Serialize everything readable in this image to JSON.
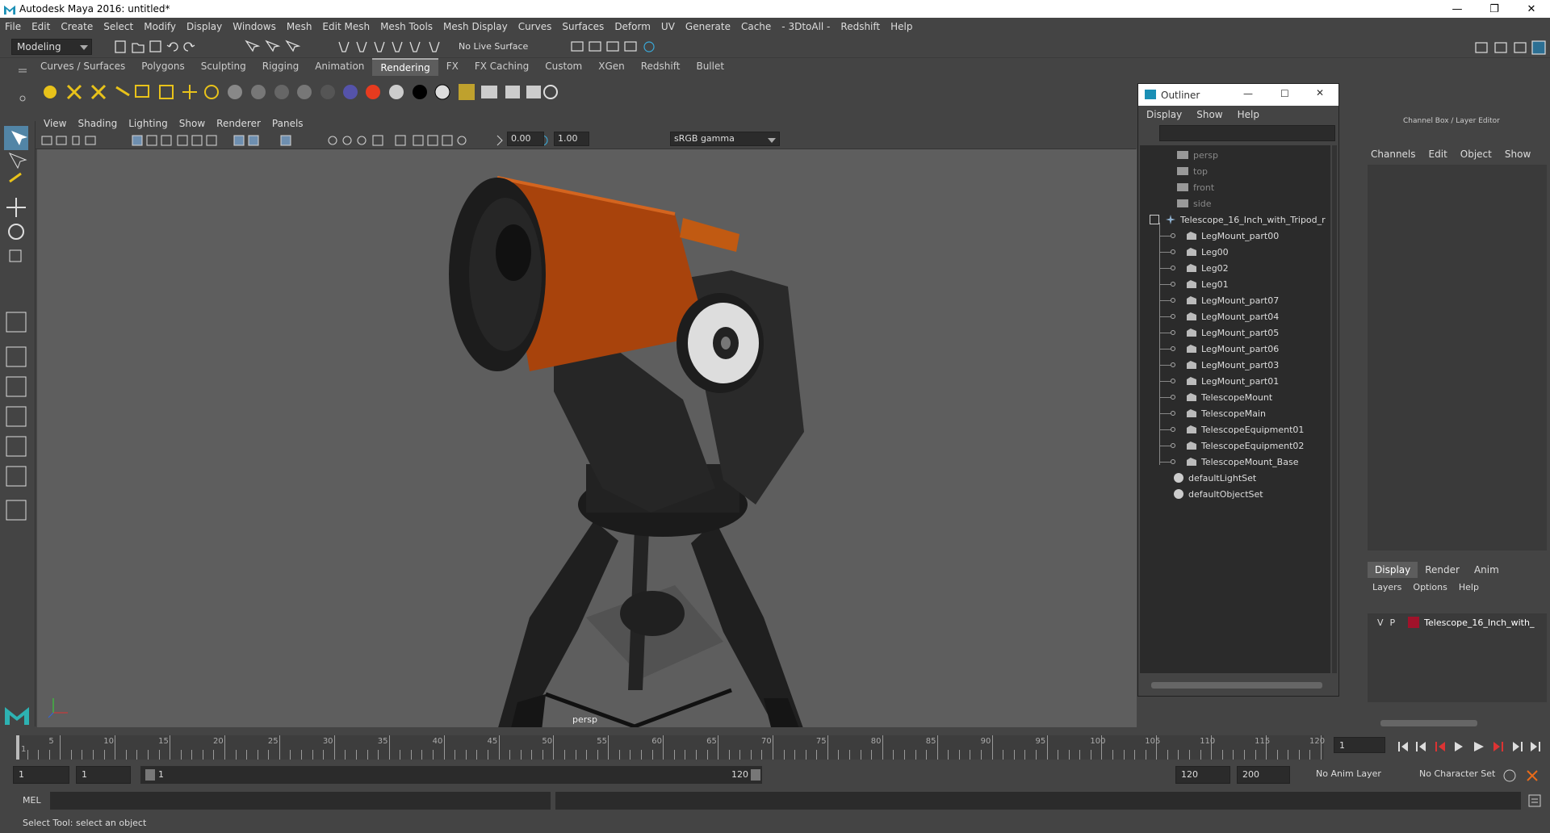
{
  "window": {
    "title": "Autodesk Maya 2016: untitled*",
    "minimize": "—",
    "restore": "❐",
    "close": "✕"
  },
  "menubar": [
    "File",
    "Edit",
    "Create",
    "Select",
    "Modify",
    "Display",
    "Windows",
    "Mesh",
    "Edit Mesh",
    "Mesh Tools",
    "Mesh Display",
    "Curves",
    "Surfaces",
    "Deform",
    "UV",
    "Generate",
    "Cache",
    "- 3DtoAll -",
    "Redshift",
    "Help"
  ],
  "status": {
    "mode": "Modeling",
    "live_surface": "No Live Surface"
  },
  "shelf_tabs": [
    "Curves / Surfaces",
    "Polygons",
    "Sculpting",
    "Rigging",
    "Animation",
    "Rendering",
    "FX",
    "FX Caching",
    "Custom",
    "XGen",
    "Redshift",
    "Bullet"
  ],
  "active_shelf_tab": "Rendering",
  "panel_menu": [
    "View",
    "Shading",
    "Lighting",
    "Show",
    "Renderer",
    "Panels"
  ],
  "panel_toolbar": {
    "exposure": "0.00",
    "gamma": "1.00",
    "color_space": "sRGB gamma"
  },
  "viewport": {
    "camera_label": "persp"
  },
  "outliner": {
    "title": "Outliner",
    "menu": [
      "Display",
      "Show",
      "Help"
    ],
    "cameras": [
      "persp",
      "top",
      "front",
      "side"
    ],
    "root": "Telescope_16_Inch_with_Tripod_r",
    "children": [
      "LegMount_part00",
      "Leg00",
      "Leg02",
      "Leg01",
      "LegMount_part07",
      "LegMount_part04",
      "LegMount_part05",
      "LegMount_part06",
      "LegMount_part03",
      "LegMount_part01",
      "TelescopeMount",
      "TelescopeMain",
      "TelescopeEquipment01",
      "TelescopeEquipment02",
      "TelescopeMount_Base"
    ],
    "sets": [
      "defaultLightSet",
      "defaultObjectSet"
    ]
  },
  "channel_box": {
    "title": "Channel Box / Layer Editor",
    "menu": [
      "Channels",
      "Edit",
      "Object",
      "Show"
    ],
    "layer_tabs": [
      "Display",
      "Render",
      "Anim"
    ],
    "layer_menu": [
      "Layers",
      "Options",
      "Help"
    ],
    "layer": {
      "v": "V",
      "p": "P",
      "name": "Telescope_16_Inch_with_",
      "color": "#a0122a"
    }
  },
  "timeline": {
    "ticks": [
      "5",
      "10",
      "15",
      "20",
      "25",
      "30",
      "35",
      "40",
      "45",
      "50",
      "55",
      "60",
      "65",
      "70",
      "75",
      "80",
      "85",
      "90",
      "95",
      "100",
      "105",
      "110",
      "115",
      "120"
    ],
    "start_label": "1",
    "current_frame": "1"
  },
  "range": {
    "start": "1",
    "playback_start": "1",
    "range_start_label": "1",
    "range_end_label": "120",
    "playback_end": "120",
    "end": "200",
    "anim_layer": "No Anim Layer",
    "char_set": "No Character Set"
  },
  "cmd": {
    "label": "MEL"
  },
  "help": {
    "text": "Select Tool: select an object"
  },
  "colors": {
    "tube": "#b04a0f",
    "layer_swatch": "#a0122a",
    "accent": "#1a8fb5"
  }
}
